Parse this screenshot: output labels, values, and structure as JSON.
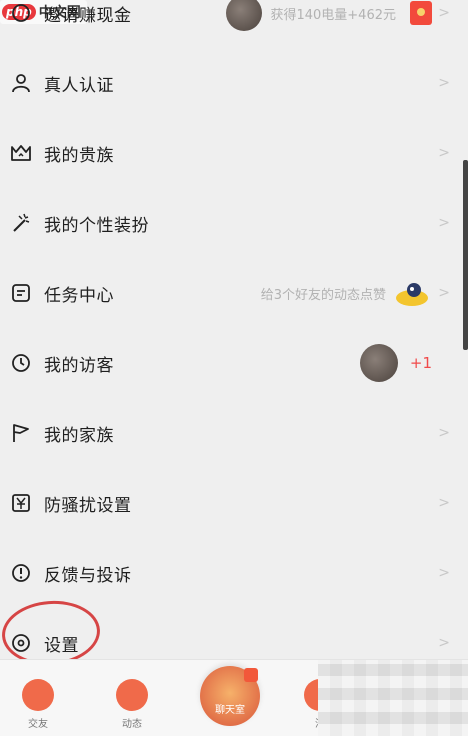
{
  "watermark": {
    "logo": "php",
    "text": "中文网"
  },
  "menu": {
    "items": [
      {
        "key": "earn",
        "label": "邀请赚现金",
        "extra_text": "获得140电量+462元"
      },
      {
        "key": "verify",
        "label": "真人认证"
      },
      {
        "key": "noble",
        "label": "我的贵族"
      },
      {
        "key": "style",
        "label": "我的个性装扮"
      },
      {
        "key": "tasks",
        "label": "任务中心",
        "extra_text": "给3个好友的动态点赞"
      },
      {
        "key": "visitors",
        "label": "我的访客",
        "extra_text": "+1"
      },
      {
        "key": "family",
        "label": "我的家族"
      },
      {
        "key": "antiharass",
        "label": "防骚扰设置"
      },
      {
        "key": "feedback",
        "label": "反馈与投诉"
      },
      {
        "key": "settings",
        "label": "设置"
      }
    ]
  },
  "tabbar": {
    "tabs": [
      {
        "label": "交友"
      },
      {
        "label": "动态"
      },
      {
        "label": "聊天室"
      },
      {
        "label": "消"
      }
    ]
  },
  "colors": {
    "accent": "#f04a4a",
    "annotation": "#d64545"
  }
}
